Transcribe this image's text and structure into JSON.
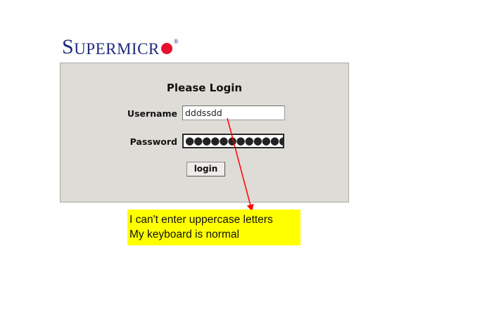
{
  "logo": {
    "first_letter": "S",
    "rest": "UPERMICR",
    "registered": "®",
    "dot_color": "#e8112d",
    "text_color": "#1f2a7a"
  },
  "login": {
    "title": "Please Login",
    "username_label": "Username",
    "username_value": "dddssdd",
    "password_label": "Password",
    "password_value": "●●●●●●●●●●●●",
    "button_label": "login"
  },
  "annotation": {
    "line1": "I can't enter uppercase letters",
    "line2": "My keyboard is normal",
    "box_color": "#ffff00",
    "arrow_color": "#ff0000"
  }
}
